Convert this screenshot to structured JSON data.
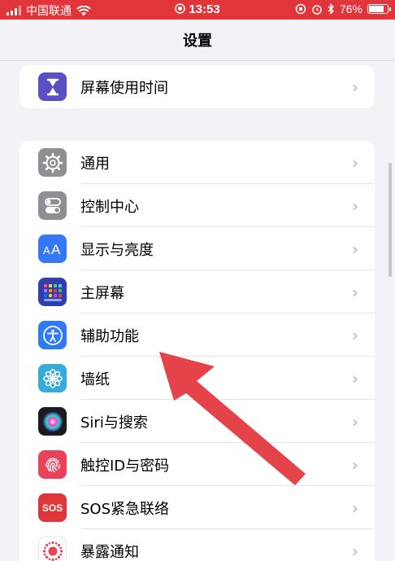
{
  "status_bar": {
    "carrier": "中国联通",
    "time": "13:53",
    "battery": "76%"
  },
  "nav": {
    "title": "设置"
  },
  "group_top": [
    {
      "label": "屏幕使用时间",
      "icon": "hourglass-icon",
      "color": "#5b4fc4"
    }
  ],
  "group_main": [
    {
      "label": "通用",
      "icon": "gear-icon",
      "color": "#8e8e93"
    },
    {
      "label": "控制中心",
      "icon": "toggles-icon",
      "color": "#8e8e93"
    },
    {
      "label": "显示与亮度",
      "icon": "text-size-icon",
      "color": "#3478f6"
    },
    {
      "label": "主屏幕",
      "icon": "app-grid-icon",
      "color": "#2f3fae"
    },
    {
      "label": "辅助功能",
      "icon": "accessibility-icon",
      "color": "#2f7bf6"
    },
    {
      "label": "墙纸",
      "icon": "flower-icon",
      "color": "#37aadc"
    },
    {
      "label": "Siri与搜索",
      "icon": "siri-icon",
      "color": "#1c1c1e"
    },
    {
      "label": "触控ID与密码",
      "icon": "fingerprint-icon",
      "color": "#e9425a"
    },
    {
      "label": "SOS紧急联络",
      "icon": "sos-icon",
      "color": "#e0353a"
    },
    {
      "label": "暴露通知",
      "icon": "exposure-icon",
      "color": "#ffffff"
    }
  ],
  "sos_text": "SOS",
  "colors": {
    "status_bar": "#e0353a",
    "annotation_arrow": "#e4434a"
  }
}
